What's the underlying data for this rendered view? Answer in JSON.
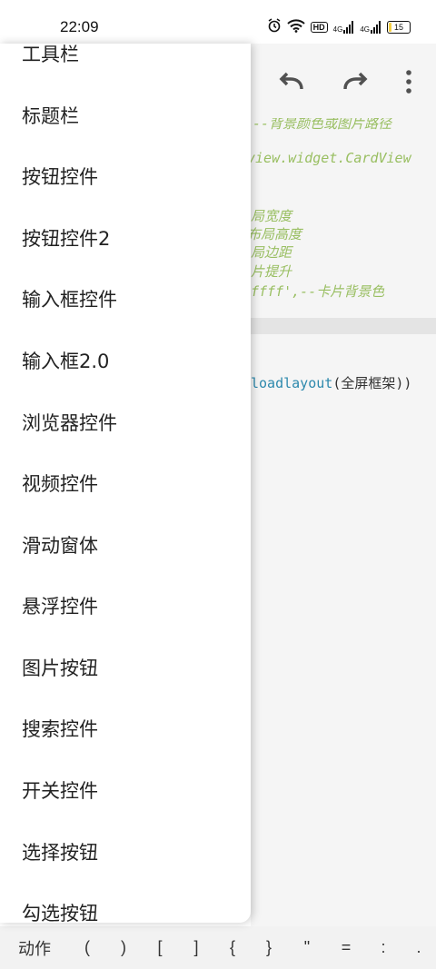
{
  "status_bar": {
    "time": "22:09",
    "hd_label": "HD",
    "net_label_1": "4G",
    "net_label_2": "4G",
    "battery": "15",
    "battery_level": 0.15
  },
  "toolbar": {
    "icons": [
      "undo-icon",
      "redo-icon",
      "more-vert-icon"
    ]
  },
  "code_lines": [
    {
      "text": "--背景颜色或图片路径",
      "kind": "comment"
    },
    {
      "text": "view.widget.CardView",
      "kind": "comment"
    },
    {
      "text": "局宽度",
      "kind": "comment"
    },
    {
      "text": "布局高度",
      "kind": "comment"
    },
    {
      "text": "局边距",
      "kind": "comment"
    },
    {
      "text": "片提升",
      "kind": "comment"
    },
    {
      "text": "ffff',--卡片背景色",
      "kind": "comment"
    },
    {
      "fn": "loadlayout",
      "text": "(全屏框架))"
    }
  ],
  "drawer": {
    "items": [
      "工具栏",
      "标题栏",
      "按钮控件",
      "按钮控件2",
      "输入框控件",
      "输入框2.0",
      "浏览器控件",
      "视频控件",
      "滑动窗体",
      "悬浮控件",
      "图片按钮",
      "搜索控件",
      "开关控件",
      "选择按钮",
      "勾选按钮"
    ]
  },
  "bottom_bar": {
    "keys": [
      "动作",
      "(",
      ")",
      "[",
      "]",
      "{",
      "}",
      "\"",
      "=",
      ":",
      "."
    ]
  },
  "colors": {
    "comment": "#a0c766",
    "function": "#2f8fb5",
    "battery": "#f5cf43"
  }
}
